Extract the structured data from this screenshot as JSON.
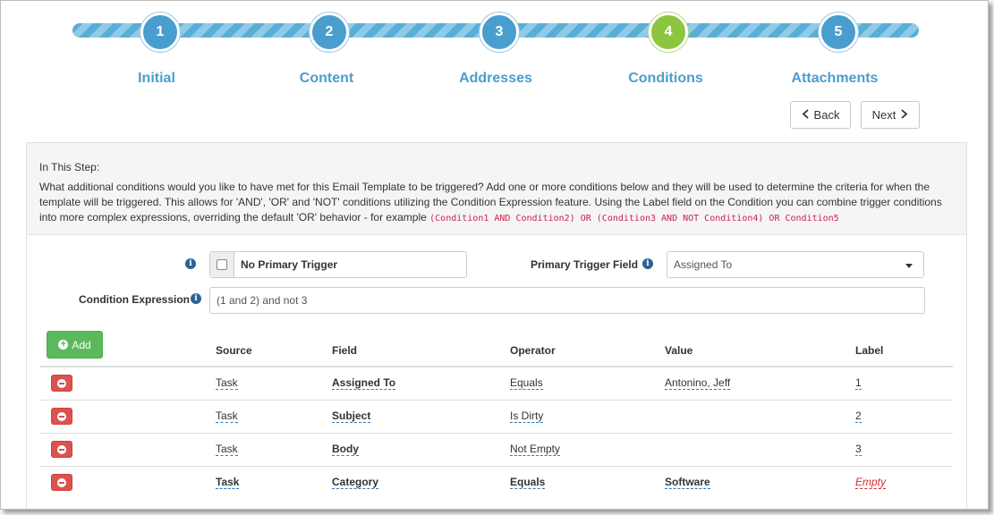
{
  "wizard": {
    "steps": [
      {
        "number": "1",
        "label": "Initial"
      },
      {
        "number": "2",
        "label": "Content"
      },
      {
        "number": "3",
        "label": "Addresses"
      },
      {
        "number": "4",
        "label": "Conditions"
      },
      {
        "number": "5",
        "label": "Attachments"
      }
    ],
    "active_step": 4
  },
  "nav": {
    "back_label": "Back",
    "next_label": "Next"
  },
  "info": {
    "title": "In This Step:",
    "text": "What additional conditions would you like to have met for this Email Template to be triggered? Add one or more conditions below and they will be used to determine the criteria for when the template will be triggered. This allows for 'AND', 'OR' and 'NOT' conditions utilizing the Condition Expression feature. Using the Label field on the Condition you can combine trigger conditions into more complex expressions, overriding the default 'OR' behavior - for example",
    "example": "(Condition1 AND Condition2) OR (Condition3 AND NOT Condition4) OR Condition5"
  },
  "form": {
    "no_primary_trigger_label": "No Primary Trigger",
    "primary_trigger_field_label": "Primary Trigger Field",
    "primary_trigger_field_value": "Assigned To",
    "condition_expression_label": "Condition Expression",
    "condition_expression_value": "(1 and 2) and not 3"
  },
  "table": {
    "add_label": "Add",
    "columns": [
      "Source",
      "Field",
      "Operator",
      "Value",
      "Label"
    ],
    "rows": [
      {
        "source": "Task",
        "field": "Assigned To",
        "operator": "Equals",
        "value": "Antonino, Jeff",
        "label": "1",
        "bold": false
      },
      {
        "source": "Task",
        "field": "Subject",
        "operator": "Is Dirty",
        "value": "",
        "label": "2",
        "bold": false
      },
      {
        "source": "Task",
        "field": "Body",
        "operator": "Not Empty",
        "value": "",
        "label": "3",
        "bold": false
      },
      {
        "source": "Task",
        "field": "Category",
        "operator": "Equals",
        "value": "Software",
        "label": "Empty",
        "bold": true
      }
    ]
  },
  "colors": {
    "step_blue": "#4a9ece",
    "step_active": "#8cc63f",
    "add_green": "#5cb85c",
    "delete_red": "#d9534f",
    "code_red": "#c7254e"
  }
}
